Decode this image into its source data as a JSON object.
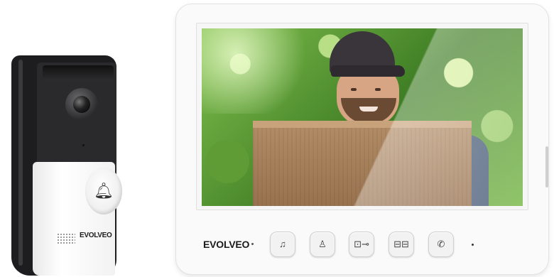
{
  "doorbell": {
    "brand": "EVOLVEO",
    "icons": [
      "camera-lens-icon",
      "bell-icon",
      "speaker-grille-icon"
    ]
  },
  "monitor": {
    "brand": "EVOLVEO",
    "buttons": [
      {
        "glyph": "♫",
        "icon": "music-note-icon"
      },
      {
        "glyph": "♙",
        "icon": "person-icon"
      },
      {
        "glyph": "⊡⊸",
        "icon": "key-unlock-icon"
      },
      {
        "glyph": "⊟⊟",
        "icon": "gate-icon"
      },
      {
        "glyph": "✆",
        "icon": "phone-icon"
      }
    ]
  },
  "colors": {
    "doorbell_body": "#1d1d1f",
    "doorbell_panel": "#f2f2f3",
    "monitor_body": "#fafafa",
    "scene_foliage": "#3f7d25"
  }
}
